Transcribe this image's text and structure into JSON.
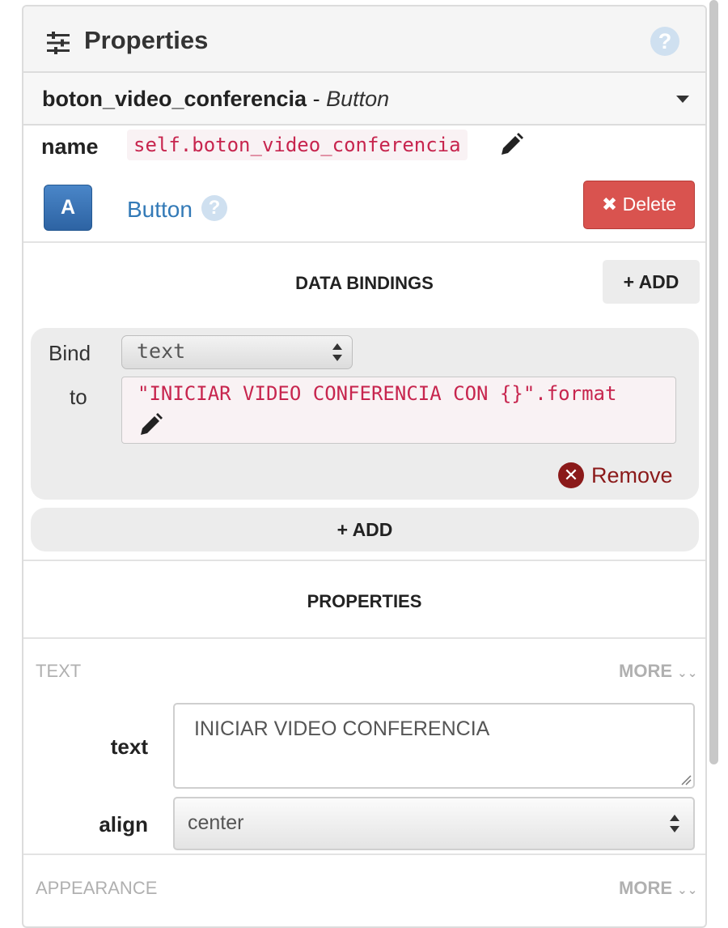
{
  "header": {
    "title": "Properties",
    "help": "?"
  },
  "selector": {
    "component_name": "boton_video_conferencia",
    "separator": " - ",
    "component_type": "Button"
  },
  "name_row": {
    "label": "name",
    "value": "self.boton_video_conferencia"
  },
  "component": {
    "icon_letter": "A",
    "link": "Button",
    "help": "?",
    "delete_label": "Delete"
  },
  "data_bindings": {
    "title": "DATA BINDINGS",
    "add_label": "ADD",
    "bind_label": "Bind",
    "to_label": "to",
    "bind_property": "text",
    "to_expression": "\"INICIAR VIDEO CONFERENCIA CON {}\".format",
    "remove_label": "Remove",
    "add_bottom_label": "ADD"
  },
  "properties": {
    "title": "PROPERTIES",
    "groups": [
      {
        "name": "TEXT",
        "more": "MORE"
      },
      {
        "name": "APPEARANCE",
        "more": "MORE"
      }
    ],
    "fields": {
      "text": {
        "label": "text",
        "value": "INICIAR VIDEO CONFERENCIA"
      },
      "align": {
        "label": "align",
        "value": "center"
      }
    }
  },
  "colors": {
    "delete": "#d9534f",
    "link": "#337ab7",
    "code": "#c7254e",
    "remove": "#8b1a1a"
  }
}
